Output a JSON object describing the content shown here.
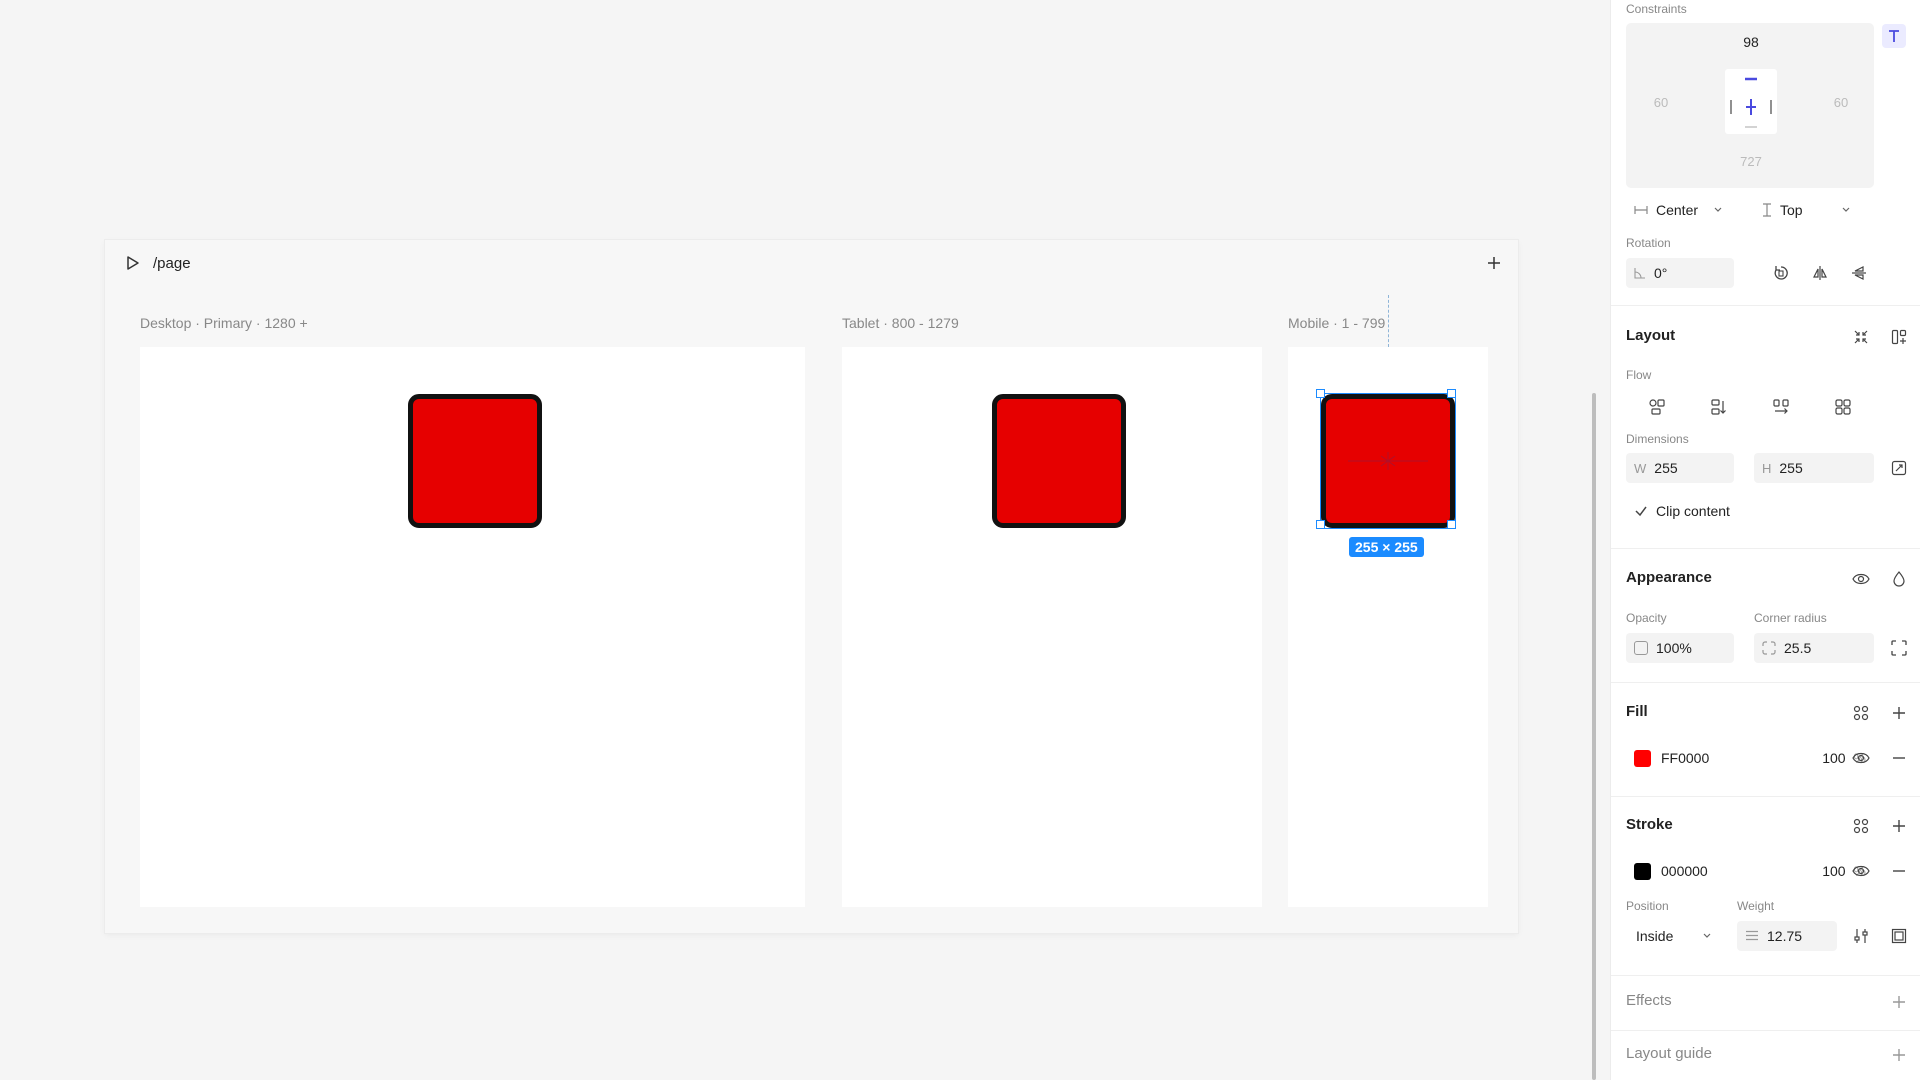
{
  "canvas": {
    "page_path": "/page",
    "breakpoints": [
      {
        "label": "Desktop · Primary · 1280 +"
      },
      {
        "label": "Tablet · 800 - 1279"
      },
      {
        "label": "Mobile · 1 - 799"
      }
    ],
    "selection_size": "255 × 255"
  },
  "panel": {
    "constraints": {
      "title": "Constraints",
      "top": "98",
      "left": "60",
      "right": "60",
      "bottom": "727",
      "horizontal": "Center",
      "vertical": "Top"
    },
    "rotation": {
      "label": "Rotation",
      "value": "0°"
    },
    "layout": {
      "title": "Layout",
      "flow_label": "Flow",
      "dimensions_label": "Dimensions",
      "width_prefix": "W",
      "width": "255",
      "height_prefix": "H",
      "height": "255",
      "clip_content": "Clip content"
    },
    "appearance": {
      "title": "Appearance",
      "opacity_label": "Opacity",
      "opacity": "100%",
      "corner_radius_label": "Corner radius",
      "corner_radius": "25.5"
    },
    "fill": {
      "title": "Fill",
      "hex": "FF0000",
      "color": "#ff0000",
      "opacity": "100",
      "unit": "%"
    },
    "stroke": {
      "title": "Stroke",
      "hex": "000000",
      "color": "#000000",
      "opacity": "100",
      "unit": "%",
      "position_label": "Position",
      "position": "Inside",
      "weight_label": "Weight",
      "weight": "12.75"
    },
    "effects": {
      "title": "Effects"
    },
    "layout_guide": {
      "title": "Layout guide"
    }
  },
  "colors": {
    "accent": "#1b8bff",
    "box_fill": "#e60000",
    "box_stroke": "#111111",
    "constraint_active": "#4a4adf"
  }
}
